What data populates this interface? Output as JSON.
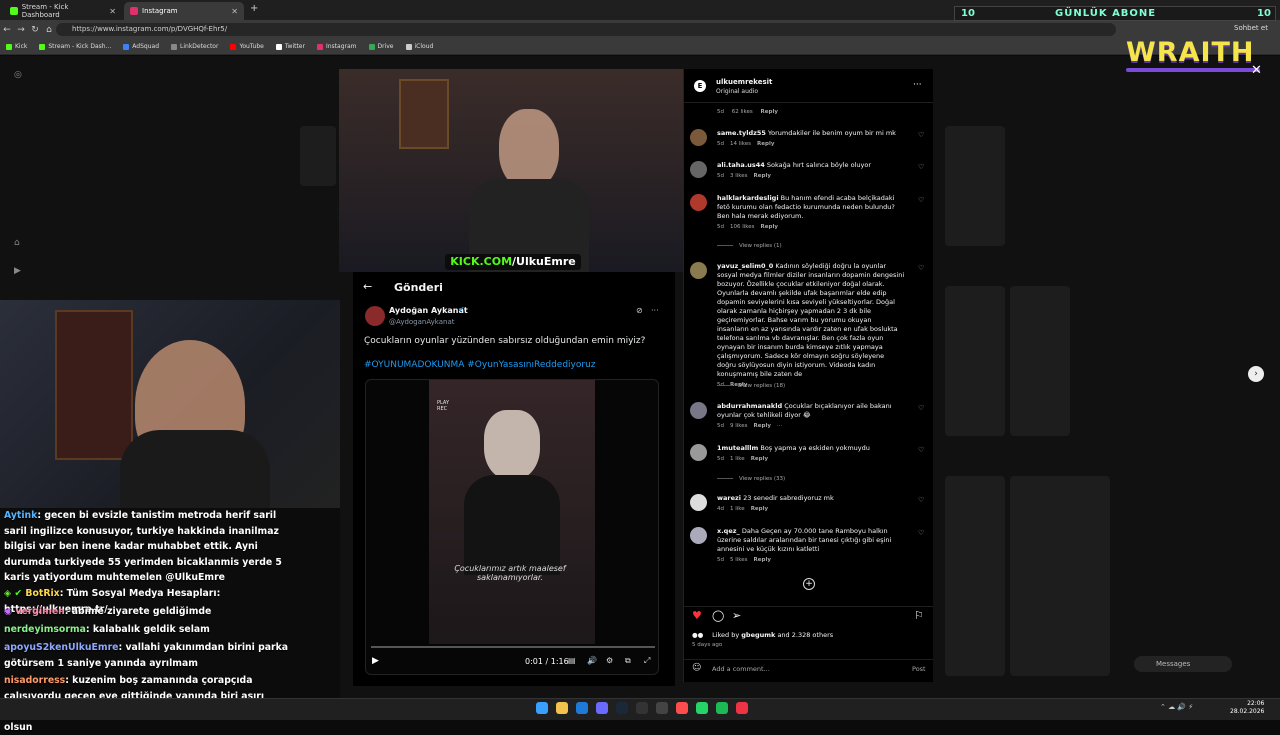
{
  "browser": {
    "tabs": [
      {
        "label": "Stream - Kick Dashboard",
        "color": "#53fc18",
        "active": false
      },
      {
        "label": "Instagram",
        "color": "#e1306c",
        "active": true
      }
    ],
    "url": "https://www.instagram.com/p/DVGHQf-Ehr5/",
    "bookmarks": [
      "Kick",
      "Stream - Kick Dash...",
      "AdSquad",
      "LinkDetector",
      "YouTube",
      "Twitter",
      "Instagram",
      "Drive",
      "iCloud"
    ],
    "sohbet": "Sohbet et"
  },
  "overlay": {
    "subs_label": "GÜNLÜK ABONE",
    "subs_left": "10",
    "subs_right": "10",
    "wraith": "WRAITH"
  },
  "stream": {
    "kick_prefix": "KICK.COM",
    "kick_suffix": "/UlkuEmre"
  },
  "tweet": {
    "header": "Gönderi",
    "name": "Aydoğan Aykanat",
    "handle": "@AydoganAykanat",
    "text": "Çocukların oyunlar yüzünden sabırsız olduğundan emin miyiz?",
    "hashtags": "#OYUNUMADOKUNMA #OyunYasasınıReddediyoruz",
    "video_subtitle": "Çocuklarımız artık maalesef saklanamıyorlar.",
    "video_time": "0:01 / 1:16",
    "video_badge": "PLAY REC"
  },
  "instagram": {
    "username": "ulkuemrekesit",
    "audio": "Original audio",
    "top_meta": {
      "age": "5d",
      "likes": "62 likes",
      "reply": "Reply"
    },
    "comments": [
      {
        "user": "same.tyldz55",
        "text": "Yorumdakiler ile benim oyum bir mi mk",
        "age": "5d",
        "likes": "14 likes",
        "reply": "Reply",
        "view_replies": ""
      },
      {
        "user": "ali.taha.us44",
        "text": "Sokağa hırt salınca böyle oluyor",
        "age": "5d",
        "likes": "3 likes",
        "reply": "Reply",
        "view_replies": ""
      },
      {
        "user": "halklarkardesligi",
        "text": "Bu hanım efendi acaba belçikadaki fetö kurumu olan fedactio kurumunda neden bulundu? Ben hala merak ediyorum.",
        "age": "5d",
        "likes": "106 likes",
        "reply": "Reply",
        "view_replies": "View replies (1)"
      },
      {
        "user": "yavuz_selim0_0",
        "text": "Kadının söylediği doğru la oyunlar sosyal medya filmler diziler insanların dopamin dengesini bozuyor. Özellikle çocuklar etkileniyor doğal olarak. Oyunlarla devamlı şekilde ufak başarımlar elde edip dopamin seviyelerini kısa seviyeli yükseltiyorlar. Doğal olarak zamanla hiçbirşey yapmadan 2 3 dk bile geçiremiyorlar. Bahse varım bu yorumu okuyan insanların en az yarısında vardır zaten en ufak boslukta telefona sarılma vb davranışlar. Ben çok fazla oyun oynayan bir insanım burda kimseye zıtlık yapmaya çalışmıyorum. Sadece kör olmayın soğru söyleyene doğru söylüyosun diyin istiyorum. Videoda kadın konuşmamış bile zaten de",
        "age": "5d",
        "likes": "",
        "reply": "Reply",
        "view_replies": "View replies (18)"
      },
      {
        "user": "abdurrahmanakld",
        "text": "Çocuklar bıçaklanıyor aile bakanı oyunlar çok tehlikeli diyor 😂",
        "age": "5d",
        "likes": "9 likes",
        "reply": "Reply",
        "view_replies": ""
      },
      {
        "user": "1mutealllm",
        "text": "Boş yapma ya eskiden yokmuydu",
        "age": "5d",
        "likes": "1 like",
        "reply": "Reply",
        "view_replies": "View replies (33)"
      },
      {
        "user": "warezi",
        "text": "23 senedir sabrediyoruz mk",
        "age": "4d",
        "likes": "1 like",
        "reply": "Reply",
        "view_replies": ""
      },
      {
        "user": "x.qez_",
        "text": "Daha Geçen ay 70.000 tane Ramboyu halkın üzerine saldılar aralarından bir tanesi çıktığı gibi eşini annesini ve küçük kızını katletti",
        "age": "5d",
        "likes": "5 likes",
        "reply": "Reply",
        "view_replies": ""
      }
    ],
    "liked_by_prefix": "Liked by",
    "liked_by_user": "gbegumk",
    "liked_by_suffix": "and 2.328 others",
    "date": "5 days ago",
    "add_comment": "Add a comment...",
    "post_label": "Post",
    "messages": "Messages"
  },
  "chat": [
    {
      "name": "Aytink",
      "color": "#56b4ff",
      "text": ": gecen bi evsizle tanistim metroda herif saril saril ingilizce konusuyor, turkiye hakkinda inanilmaz bilgisi var ben inene kadar muhabbet ettik. Ayni durumda turkiyede 55 yerimden bicaklanmis yerde 5 karis yatiyordum muhtemelen @UlkuEmre"
    },
    {
      "name": "BotRix",
      "color": "#ffd84a",
      "text": ": Tüm Sosyal Medya Hesapları: https://ulkuemre.tr/"
    },
    {
      "name": "vergimen",
      "color": "#ff8aa8",
      "text": ": abime ziyarete geldiğimde"
    },
    {
      "name": "nerdeyimsorma",
      "color": "#8af28a",
      "text": ": kalabalık geldik selam"
    },
    {
      "name": "apoyuS2kenUlkuEmre",
      "color": "#8fa8ff",
      "text": ": vallahi yakınımdan birini parka götürsem 1 saniye yanında ayrılmam"
    },
    {
      "name": "nisadorress",
      "color": "#ff9a6a",
      "text": ": kuzenim boş zamanında çorapçıda çalışıyordu geçen eve gittiğinde yanında biri aşırı dozdan ölmüş daha götürmediler bu da bir örnek olsun"
    }
  ],
  "taskbar": {
    "time": "22:06",
    "date": "28.02.2026"
  }
}
